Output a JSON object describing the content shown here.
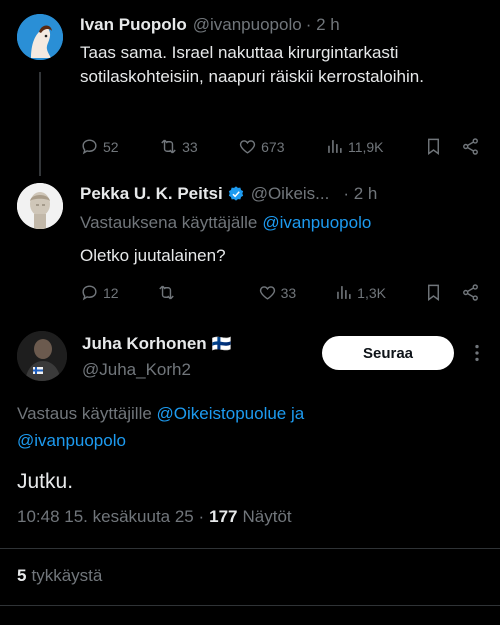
{
  "tweet1": {
    "name": "Ivan Puopolo",
    "handle": "@ivanpuopolo",
    "time": "· 2 h",
    "text": "Taas sama. Israel nakuttaa kirurgintarkasti sotilaskohteisiin, naapuri räiskii kerrostaloihin.",
    "replies": "52",
    "retweets": "33",
    "likes": "673",
    "views": "11,9K"
  },
  "tweet2": {
    "name": "Pekka U. K. Peitsi",
    "handle": "@Oikeis...",
    "time": "· 2 h",
    "reply_prefix": "Vastauksena käyttäjälle",
    "reply_to": "@ivanpuopolo",
    "text": "Oletko juutalainen?",
    "replies": "12",
    "retweets": "",
    "likes": "33",
    "views": "1,3K"
  },
  "main": {
    "name": "Juha Korhonen",
    "flag": "🇫🇮",
    "handle": "@Juha_Korh2",
    "follow_label": "Seuraa",
    "reply_prefix": "Vastaus käyttäjille",
    "reply_to1": "@Oikeistopuolue",
    "reply_and": "ja",
    "reply_to2": "@ivanpuopolo",
    "text": "Jutku.",
    "timestamp": "10:48 15. kesäkuuta 25 ·",
    "views_count": "177",
    "views_label": "Näytöt",
    "likes_count": "5",
    "likes_label": "tykkäystä"
  },
  "colors": {
    "accent": "#1d9bf0",
    "muted": "#71767b",
    "bg": "#000000"
  }
}
